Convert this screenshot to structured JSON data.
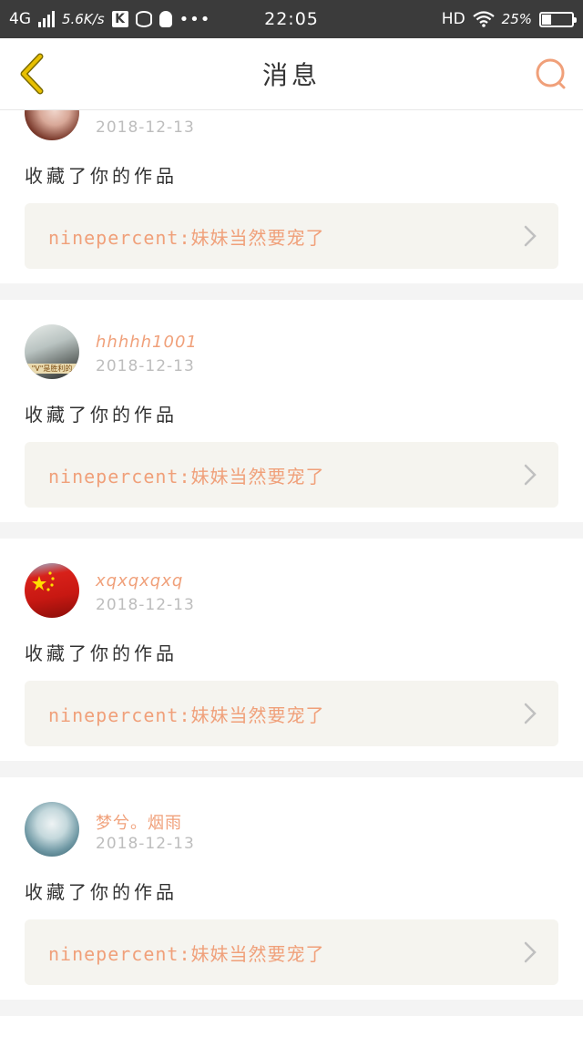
{
  "status_bar": {
    "network": "4G",
    "speed": "5.6K/s",
    "k_label": "K",
    "time": "22:05",
    "hd": "HD",
    "battery_pct": "25%"
  },
  "header": {
    "title": "消息",
    "back_icon": "chevron-left-icon",
    "search_icon": "search-icon"
  },
  "colors": {
    "accent": "#f0a07a",
    "back": "#e8c000",
    "quote_bg": "#f5f4ef"
  },
  "messages": [
    {
      "username": "",
      "date": "2018-12-13",
      "action": "收藏了你的作品",
      "quote": "ninepercent:妹妹当然要宠了"
    },
    {
      "username": "hhhhh1001",
      "date": "2018-12-13",
      "action": "收藏了你的作品",
      "quote": "ninepercent:妹妹当然要宠了",
      "avatar_text": "\"V\"是胜利的"
    },
    {
      "username": "xqxqxqxq",
      "date": "2018-12-13",
      "action": "收藏了你的作品",
      "quote": "ninepercent:妹妹当然要宠了"
    },
    {
      "username": "梦兮。烟雨",
      "date": "2018-12-13",
      "action": "收藏了你的作品",
      "quote": "ninepercent:妹妹当然要宠了"
    }
  ]
}
